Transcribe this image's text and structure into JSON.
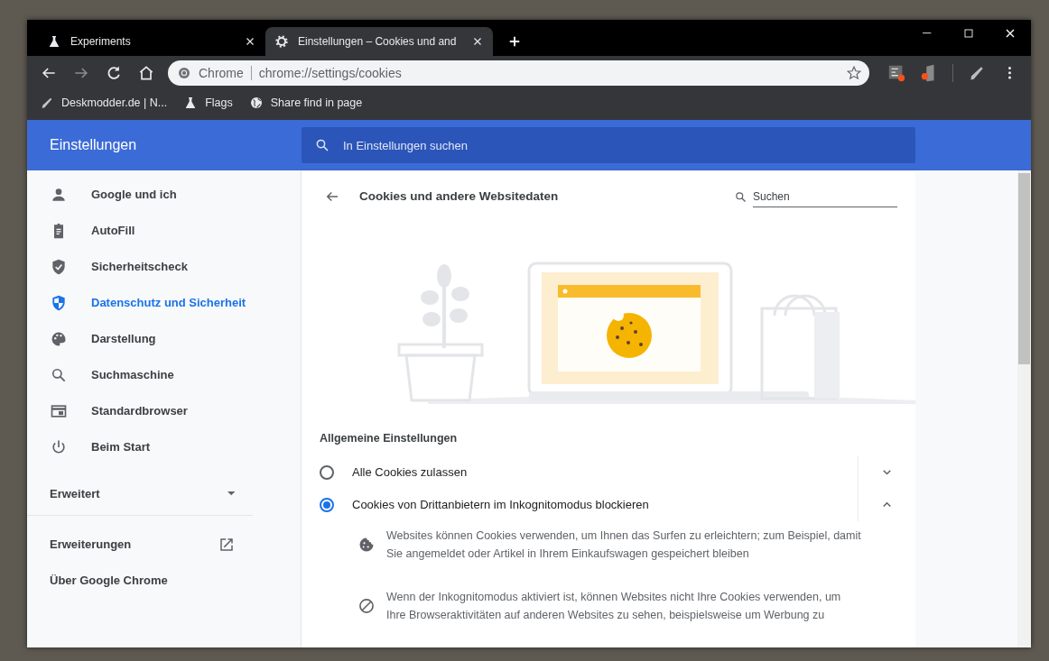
{
  "tabs": [
    {
      "title": "Experiments",
      "selected": false
    },
    {
      "title": "Einstellungen – Cookies und and",
      "selected": true
    }
  ],
  "omnibox": {
    "chip": "Chrome",
    "url": "chrome://settings/cookies"
  },
  "bookmarks": [
    {
      "label": "Deskmodder.de | N..."
    },
    {
      "label": "Flags"
    },
    {
      "label": "Share find in page"
    }
  ],
  "settings_header": {
    "title": "Einstellungen",
    "search_placeholder": "In Einstellungen suchen"
  },
  "sidebar": {
    "items": [
      {
        "label": "Google und ich",
        "selected": false
      },
      {
        "label": "AutoFill",
        "selected": false
      },
      {
        "label": "Sicherheitscheck",
        "selected": false
      },
      {
        "label": "Datenschutz und Sicherheit",
        "selected": true
      },
      {
        "label": "Darstellung",
        "selected": false
      },
      {
        "label": "Suchmaschine",
        "selected": false
      },
      {
        "label": "Standardbrowser",
        "selected": false
      },
      {
        "label": "Beim Start",
        "selected": false
      }
    ],
    "advanced": {
      "label": "Erweitert",
      "expanded": false
    },
    "links": [
      {
        "label": "Erweiterungen",
        "external": true
      },
      {
        "label": "Über Google Chrome",
        "external": false
      }
    ]
  },
  "page": {
    "title": "Cookies und andere Websitedaten",
    "search_placeholder": "Suchen",
    "section_heading": "Allgemeine Einstellungen",
    "options": [
      {
        "label": "Alle Cookies zulassen",
        "selected": false,
        "expanded": false
      },
      {
        "label": "Cookies von Drittanbietern im Inkognitomodus blockieren",
        "selected": true,
        "expanded": true
      }
    ],
    "details": [
      {
        "text": "Websites können Cookies verwenden, um Ihnen das Surfen zu erleichtern; zum Beispiel, damit Sie angemeldet oder Artikel in Ihrem Einkaufswagen gespeichert bleiben"
      },
      {
        "text": "Wenn der Inkognitomodus aktiviert ist, können Websites nicht Ihre Cookies verwenden, um Ihre Browseraktivitäten auf anderen Websites zu sehen, beispielsweise um Werbung zu"
      }
    ]
  }
}
